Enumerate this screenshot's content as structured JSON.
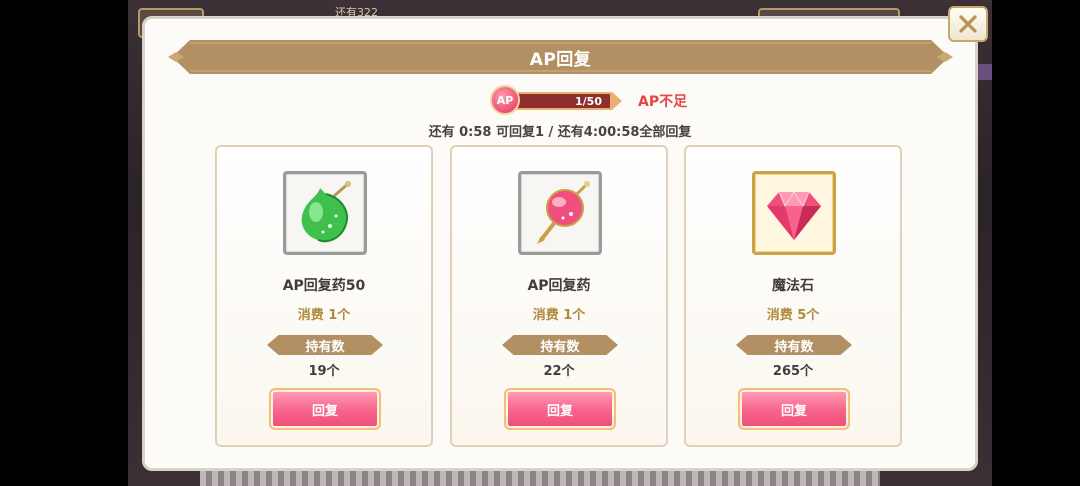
{
  "background": {
    "hint_text": "还有322"
  },
  "dialog": {
    "title": "AP回复",
    "close_icon": "close-x-icon"
  },
  "ap": {
    "badge_label": "AP",
    "current": 1,
    "max": 50,
    "gauge_text": "1/50",
    "status": "AP不足",
    "timer_text": "还有 0:58 可回复1 / 还有4:00:58全部回复"
  },
  "items": [
    {
      "icon": "green-potion-icon",
      "name": "AP回复药50",
      "cost": "消费 1个",
      "owned_label": "持有数",
      "owned_count": "19个",
      "button_label": "回复"
    },
    {
      "icon": "pink-potion-icon",
      "name": "AP回复药",
      "cost": "消费 1个",
      "owned_label": "持有数",
      "owned_count": "22个",
      "button_label": "回复"
    },
    {
      "icon": "magic-stone-gem-icon",
      "name": "魔法石",
      "cost": "消费 5个",
      "owned_label": "持有数",
      "owned_count": "265个",
      "button_label": "回复"
    }
  ],
  "colors": {
    "banner": "#b39063",
    "accent_pink": "#f7638b",
    "status_red": "#e54545",
    "cost_gold": "#b08a3e"
  }
}
